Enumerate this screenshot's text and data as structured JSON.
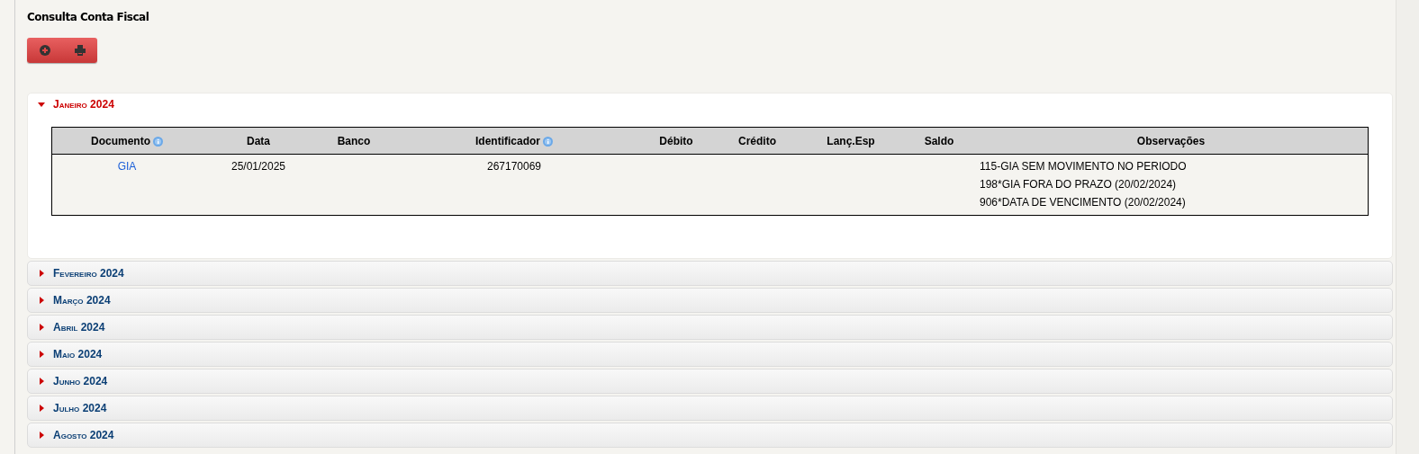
{
  "page": {
    "title": "Consulta Conta Fiscal"
  },
  "toolbar": {
    "buttons": [
      {
        "kind": "add"
      },
      {
        "kind": "print"
      }
    ]
  },
  "sections": [
    {
      "label": "Janeiro 2024",
      "expanded": true,
      "table": {
        "columns": [
          {
            "label": "Documento",
            "help": true
          },
          {
            "label": "Data",
            "help": false
          },
          {
            "label": "Banco",
            "help": false
          },
          {
            "label": "Identificador",
            "help": true
          },
          {
            "label": "Débito",
            "help": false
          },
          {
            "label": "Crédito",
            "help": false
          },
          {
            "label": "Lanç.Esp",
            "help": false
          },
          {
            "label": "Saldo",
            "help": false
          },
          {
            "label": "Observações",
            "help": false
          }
        ],
        "rows": [
          {
            "documento": "GIA",
            "data": "25/01/2025",
            "banco": "",
            "identificador": "267170069",
            "debito": "",
            "credito": "",
            "lanc_esp": "",
            "saldo": "",
            "observacoes": [
              "115-GIA SEM MOVIMENTO NO PERIODO",
              "198*GIA FORA DO PRAZO (20/02/2024)",
              "906*DATA DE VENCIMENTO (20/02/2024)"
            ]
          }
        ]
      }
    },
    {
      "label": "Fevereiro 2024",
      "expanded": false
    },
    {
      "label": "Março 2024",
      "expanded": false
    },
    {
      "label": "Abril 2024",
      "expanded": false
    },
    {
      "label": "Maio 2024",
      "expanded": false
    },
    {
      "label": "Junho 2024",
      "expanded": false
    },
    {
      "label": "Julho 2024",
      "expanded": false
    },
    {
      "label": "Agosto 2024",
      "expanded": false
    }
  ]
}
